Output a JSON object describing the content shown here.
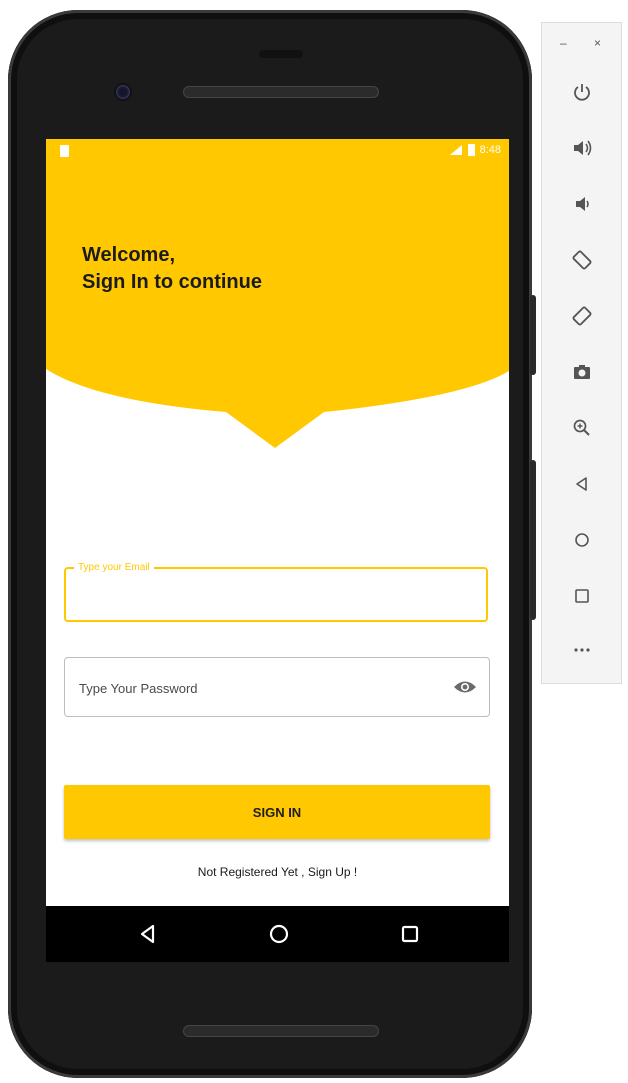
{
  "status_bar": {
    "time": "8:48"
  },
  "header": {
    "line1": "Welcome,",
    "line2": "Sign In to continue"
  },
  "form": {
    "email_label": "Type your Email",
    "email_value": "",
    "password_placeholder": "Type Your Password",
    "password_value": ""
  },
  "actions": {
    "signin_label": "SIGN IN",
    "signup_link": "Not Registered Yet , Sign Up !"
  },
  "colors": {
    "accent": "#ffc800",
    "text_dark": "#1b1b1b",
    "frame": "#1b1b1b"
  },
  "nav_icons": [
    "back-triangle-icon",
    "home-circle-icon",
    "recents-square-icon"
  ],
  "emulator_toolbar": {
    "minimize": "–",
    "close": "×",
    "icons": [
      "power-icon",
      "volume-up-icon",
      "volume-down-icon",
      "rotate-left-icon",
      "rotate-right-icon",
      "camera-icon",
      "zoom-icon",
      "back-icon",
      "home-icon",
      "overview-icon",
      "more-icon"
    ]
  }
}
